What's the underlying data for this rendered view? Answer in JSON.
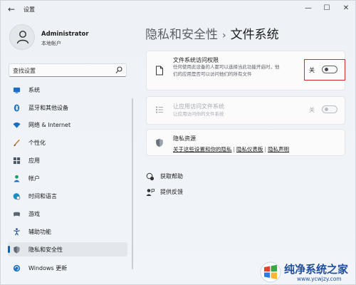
{
  "window": {
    "title": "设置"
  },
  "user": {
    "name": "Administrator",
    "account_type": "本地帐户"
  },
  "search": {
    "placeholder": "查找设置"
  },
  "sidebar": {
    "items": [
      {
        "label": "系统",
        "icon": "monitor-icon"
      },
      {
        "label": "蓝牙和其他设备",
        "icon": "bluetooth-icon"
      },
      {
        "label": "网络 & Internet",
        "icon": "wifi-icon"
      },
      {
        "label": "个性化",
        "icon": "brush-icon"
      },
      {
        "label": "应用",
        "icon": "apps-icon"
      },
      {
        "label": "帐户",
        "icon": "person-icon"
      },
      {
        "label": "时间和语言",
        "icon": "globe-clock-icon"
      },
      {
        "label": "游戏",
        "icon": "gamepad-icon"
      },
      {
        "label": "辅助功能",
        "icon": "accessibility-icon"
      },
      {
        "label": "隐私和安全性",
        "icon": "shield-icon",
        "active": true
      },
      {
        "label": "Windows 更新",
        "icon": "update-icon"
      }
    ]
  },
  "header": {
    "parent": "隐私和安全性",
    "separator": "›",
    "current": "文件系统"
  },
  "cards": {
    "file_access": {
      "title": "文件系统访问权限",
      "description": "任何使用此设备的人都可以选择当此功能开启时，他们的应用是否可以访问他们的所有文件",
      "toggle_state": "关",
      "toggle_on": false
    },
    "app_access": {
      "title": "让应用访问文件系统",
      "description": "让应用访问你的文件系统",
      "toggle_state": "关",
      "toggle_on": false,
      "disabled": true
    },
    "privacy": {
      "title": "隐私资源",
      "links": [
        "关于这些设置和你的隐私",
        "隐私仪表板",
        "隐私声明"
      ]
    }
  },
  "help": {
    "get_help": "获取帮助",
    "feedback": "提供反馈"
  },
  "watermark": {
    "text": "纯净系统之家",
    "url": "www.ycwjzy.com"
  },
  "colors": {
    "accent": "#0067c0",
    "highlight_border": "#d22b2b",
    "watermark": "#1f4ea0"
  }
}
